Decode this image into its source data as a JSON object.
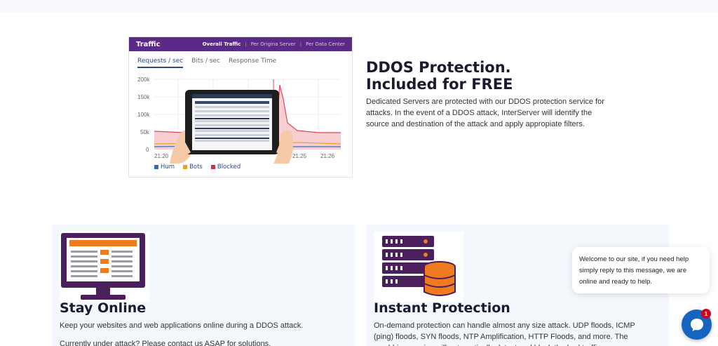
{
  "traffic_panel": {
    "title": "Traffic",
    "tabs": [
      "Overall Traffic",
      "Per Origina Server",
      "Per Data Center"
    ],
    "subtabs": [
      "Requests / sec",
      "Bits / sec",
      "Response Time"
    ],
    "y_ticks": [
      "200k",
      "150k",
      "100k",
      "50k",
      "0"
    ],
    "x_ticks": [
      "21:20",
      "21:25",
      "21:26"
    ],
    "legend": [
      {
        "label": "Hum",
        "color": "#2d6fb8"
      },
      {
        "label": "Bots",
        "color": "#f0a020"
      },
      {
        "label": "Blocked",
        "color": "#d0304a"
      }
    ]
  },
  "ddos": {
    "title_line1": "DDOS Protection.",
    "title_line2": "Included for FREE",
    "description": "Dedicated Servers are protected with our DDOS protection service for attacks. In the event of a DDOS attack, InterServer will identify the source and destination of the attack and apply appropiate filters."
  },
  "cards": [
    {
      "title": "Stay Online",
      "text1": "Keep your websites and web applications online during a DDOS attack.",
      "text2": "Currently under attack? Please contact us ASAP for solutions.",
      "icon": "monitor-icon"
    },
    {
      "title": "Instant Protection",
      "text1": "On-demand protection can handle almost any size attack. UDP floods, ICMP (ping) floods, SYN floods, NTP Amplification, HTTP Floods, and more. The scrubbing service will automatically detect and block the bad traffic.",
      "icon": "server-database-icon"
    }
  ],
  "chat": {
    "message": "Welcome to our site, if you need help simply reply to this message, we are online and ready to help.",
    "badge_count": "1",
    "icon": "chat-icon"
  },
  "colors": {
    "brand_purple": "#5b2a86",
    "accent_orange": "#f07a20",
    "chat_blue": "#1565c0",
    "card_bg": "#f4f8fd"
  }
}
